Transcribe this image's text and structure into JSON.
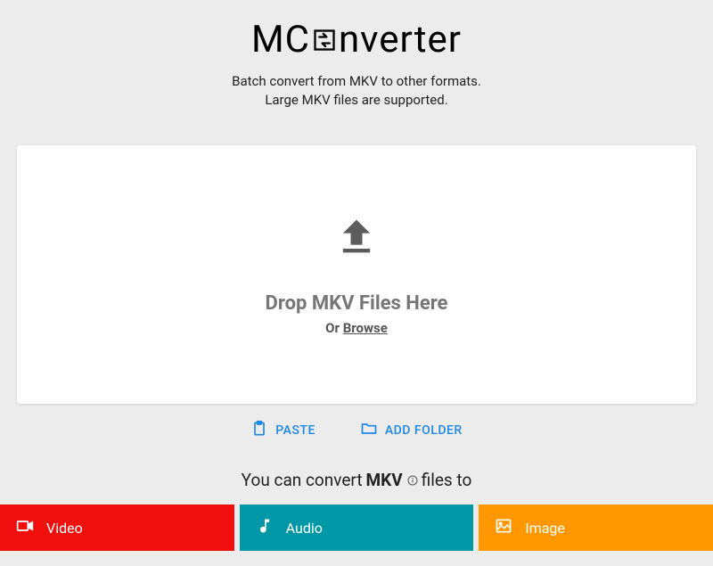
{
  "logo": {
    "part1": "MC",
    "part2": "nverter"
  },
  "subtitle": {
    "line1": "Batch convert from MKV to other formats.",
    "line2": "Large MKV files are supported."
  },
  "dropzone": {
    "main_text": "Drop MKV Files Here",
    "or_text": "Or ",
    "browse_text": "Browse"
  },
  "actions": {
    "paste": "PASTE",
    "add_folder": "ADD FOLDER"
  },
  "convert": {
    "prefix": "You can convert ",
    "format": "MKV",
    "suffix": " files to"
  },
  "categories": {
    "video": "Video",
    "audio": "Audio",
    "image": "Image"
  }
}
